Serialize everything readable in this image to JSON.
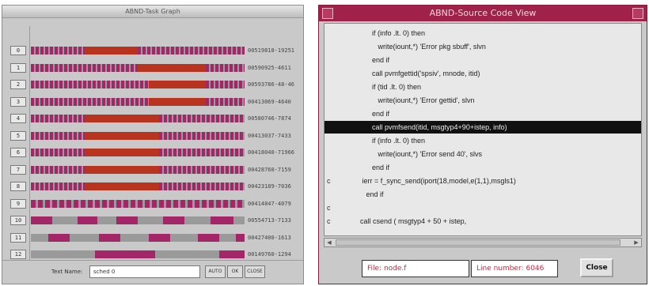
{
  "task_graph": {
    "title": "ABND-Task Graph",
    "text_label": "Text Name:",
    "text_value": "sched 0",
    "buttons": [
      "AUTO",
      "OK",
      "CLOSE"
    ],
    "colors": {
      "red": "#b8341e",
      "magenta": "#a32669",
      "gray": "#9a9a9a"
    },
    "rows": [
      {
        "id": "0",
        "tick": "00519818-19251"
      },
      {
        "id": "1",
        "tick": "00590925-4611"
      },
      {
        "id": "2",
        "tick": "00593786-48-46"
      },
      {
        "id": "3",
        "tick": "00413069-4640"
      },
      {
        "id": "4",
        "tick": "00580746-7874"
      },
      {
        "id": "5",
        "tick": "00413037-7433"
      },
      {
        "id": "6",
        "tick": "00418040-71966"
      },
      {
        "id": "7",
        "tick": "00428760-7159"
      },
      {
        "id": "8",
        "tick": "00423189-7036"
      },
      {
        "id": "9",
        "tick": "00414847-4079"
      },
      {
        "id": "10",
        "tick": "00554713-7133"
      },
      {
        "id": "11",
        "tick": "00427400-1613"
      },
      {
        "id": "12",
        "tick": "00149760-1294"
      }
    ]
  },
  "source_view": {
    "title": "ABND-Source Code View",
    "code_lines": [
      {
        "margin": "",
        "text": "                        if (info .lt. 0) then"
      },
      {
        "margin": "",
        "text": "                           write(iount,*) 'Error pkg sbuff', slvn"
      },
      {
        "margin": "",
        "text": "                        end if"
      },
      {
        "margin": "",
        "text": "                        call pvmfgettid('spsiv', mnode, itid)"
      },
      {
        "margin": "",
        "text": "                        if (tid .lt. 0) then"
      },
      {
        "margin": "",
        "text": "                           write(iount,*) 'Error gettid', slvn"
      },
      {
        "margin": "",
        "text": "                        end if"
      },
      {
        "margin": "",
        "text": "                        call pvmfsend(itid, msgtyp4+90+istep, info)",
        "selected": true
      },
      {
        "margin": "",
        "text": "                        if (info .lt. 0) then"
      },
      {
        "margin": "",
        "text": "                           write(iount,*) 'Error send 40', slvs"
      },
      {
        "margin": "",
        "text": "                        end if"
      },
      {
        "margin": "c",
        "text": "                   ierr = f_sync_send(iport(18,model,e(1,1),msgls1)"
      },
      {
        "margin": "",
        "text": "                     end if"
      },
      {
        "margin": "c",
        "text": ""
      },
      {
        "margin": "c",
        "text": "                  call csend ( msgtyp4 + 50 + istep,"
      }
    ],
    "file_label": "File: node.f",
    "line_label": "Line number: 6046",
    "close_label": "Close"
  }
}
